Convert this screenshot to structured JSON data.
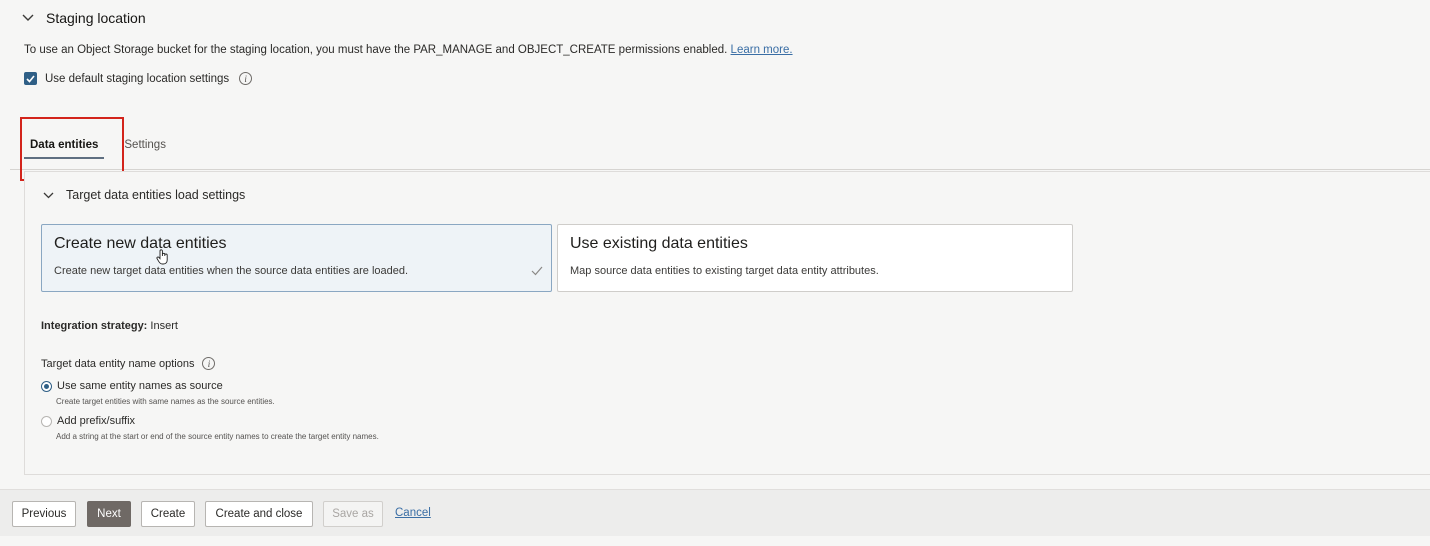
{
  "staging": {
    "title": "Staging location",
    "description": "To use an Object Storage bucket for the staging location, you must have the PAR_MANAGE and OBJECT_CREATE permissions enabled.",
    "learn_more": "Learn more.",
    "default_checkbox_label": "Use default staging location settings",
    "default_checked": true
  },
  "tabs": [
    {
      "label": "Data entities",
      "active": true
    },
    {
      "label": "Settings",
      "active": false
    }
  ],
  "target_section": {
    "title": "Target data entities load settings",
    "cards": [
      {
        "title": "Create new data entities",
        "description": "Create new target data entities when the source data entities are loaded.",
        "selected": true
      },
      {
        "title": "Use existing data entities",
        "description": "Map source data entities to existing target data entity attributes.",
        "selected": false
      }
    ],
    "integration_label": "Integration strategy:",
    "integration_value": "Insert",
    "name_options_label": "Target data entity name options",
    "radio_options": [
      {
        "label": "Use same entity names as source",
        "help": "Create target entities with same names as the source entities.",
        "checked": true
      },
      {
        "label": "Add prefix/suffix",
        "help": "Add a string at the start or end of the source entity names to create the target entity names.",
        "checked": false
      }
    ]
  },
  "footer": {
    "previous": "Previous",
    "next": "Next",
    "create": "Create",
    "create_close": "Create and close",
    "save_as": "Save as",
    "cancel": "Cancel"
  },
  "colors": {
    "accent": "#2f5f86",
    "highlight": "#d3241b",
    "primary_button": "#6f6965",
    "link": "#3a6ea5"
  }
}
